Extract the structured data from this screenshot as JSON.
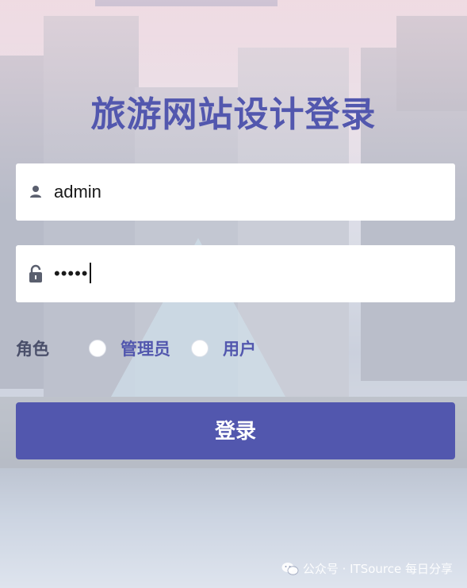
{
  "page": {
    "title": "旅游网站设计登录"
  },
  "form": {
    "username": {
      "value": "admin",
      "icon": "user-icon"
    },
    "password": {
      "masked_value": "•••••",
      "icon": "lock-icon"
    },
    "role": {
      "label": "角色",
      "options": [
        "管理员",
        "用户"
      ],
      "selected": null
    },
    "submit_label": "登录"
  },
  "watermark": {
    "text": "公众号 · ITSource 每日分享",
    "icon": "wechat-icon"
  },
  "colors": {
    "accent": "#5257ae",
    "field_bg": "#ffffff"
  }
}
